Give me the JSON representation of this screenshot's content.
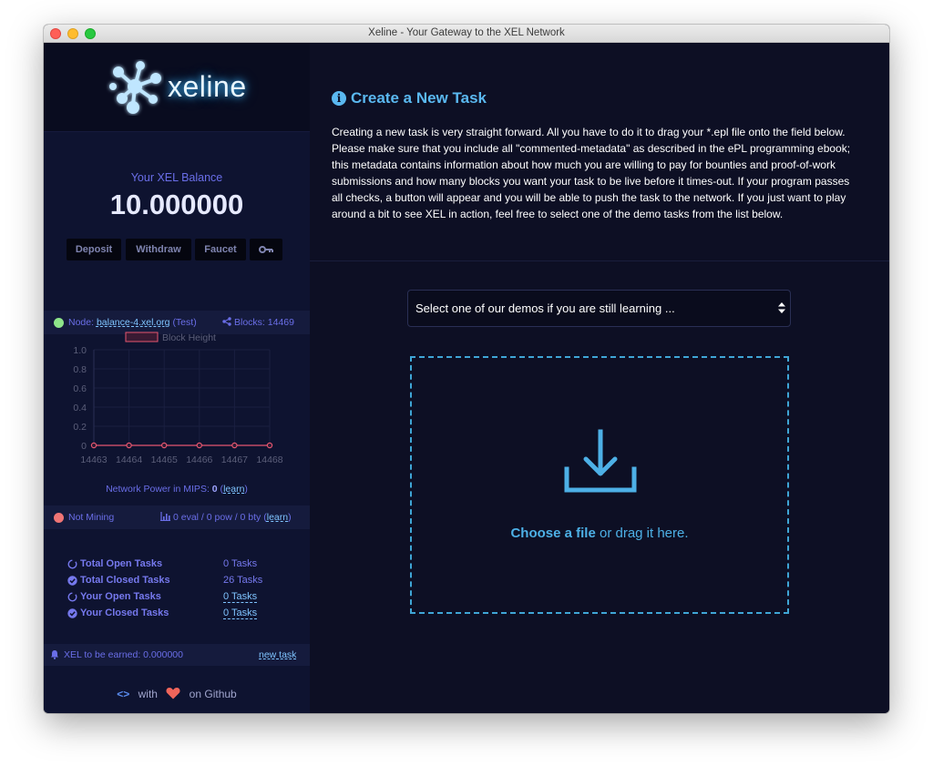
{
  "window": {
    "title": "Xeline - Your Gateway to the XEL Network"
  },
  "logo": {
    "text": "xeline"
  },
  "balance": {
    "label": "Your XEL Balance",
    "value": "10.000000",
    "buttons": [
      "Deposit",
      "Withdraw",
      "Faucet"
    ],
    "key_icon": "key-icon"
  },
  "node": {
    "prefix": "Node:",
    "host": "balance-4.xel.org",
    "network": "(Test)",
    "blocks_label": "Blocks: 14469",
    "status_color": "#8ee58a"
  },
  "chart_data": {
    "type": "line",
    "legend": "Block Height",
    "x": [
      "14463",
      "14464",
      "14465",
      "14466",
      "14467",
      "14468"
    ],
    "series": [
      {
        "name": "Block Height",
        "values": [
          0,
          0,
          0,
          0,
          0,
          0
        ]
      }
    ],
    "yticks": [
      "1.0",
      "0.8",
      "0.6",
      "0.4",
      "0.2",
      "0"
    ],
    "ylim": [
      0,
      1.0
    ],
    "color": "#e5566f"
  },
  "network_power": {
    "label": "Network Power in MIPS:",
    "value": "0",
    "learn": "learn"
  },
  "mining": {
    "status": "Not Mining",
    "stats": "0 eval / 0 pow / 0 bty",
    "learn": "learn",
    "status_color": "#f07575"
  },
  "tasks": [
    {
      "label": "Total Open Tasks",
      "value": "0 Tasks",
      "icon": "circle-outline-icon",
      "link": false
    },
    {
      "label": "Total Closed Tasks",
      "value": "26 Tasks",
      "icon": "check-circle-icon",
      "link": false
    },
    {
      "label": "Your Open Tasks",
      "value": "0 Tasks",
      "icon": "circle-outline-icon",
      "link": true
    },
    {
      "label": "Your Closed Tasks",
      "value": "0 Tasks",
      "icon": "check-circle-icon",
      "link": true
    }
  ],
  "earn": {
    "label": "XEL to be earned: 0.000000",
    "new_task": "new task"
  },
  "footer": {
    "with": "with",
    "on": "on Github"
  },
  "main": {
    "title": "Create a New Task",
    "description": "Creating a new task is very straight forward. All you have to do it to drag your *.epl file onto the field below. Please make sure that you include all \"commented-metadata\" as described in the ePL programming ebook; this metadata contains information about how much you are willing to pay for bounties and proof-of-work submissions and how many blocks you want your task to be live before it times-out. If your program passes all checks, a button will appear and you will be able to push the task to the network. If you just want to play around a bit to see XEL in action, feel free to select one of the demo tasks from the list below.",
    "select_placeholder": "Select one of our demos if you are still learning ...",
    "drop_choose": "Choose a file",
    "drop_rest": " or drag it here."
  }
}
